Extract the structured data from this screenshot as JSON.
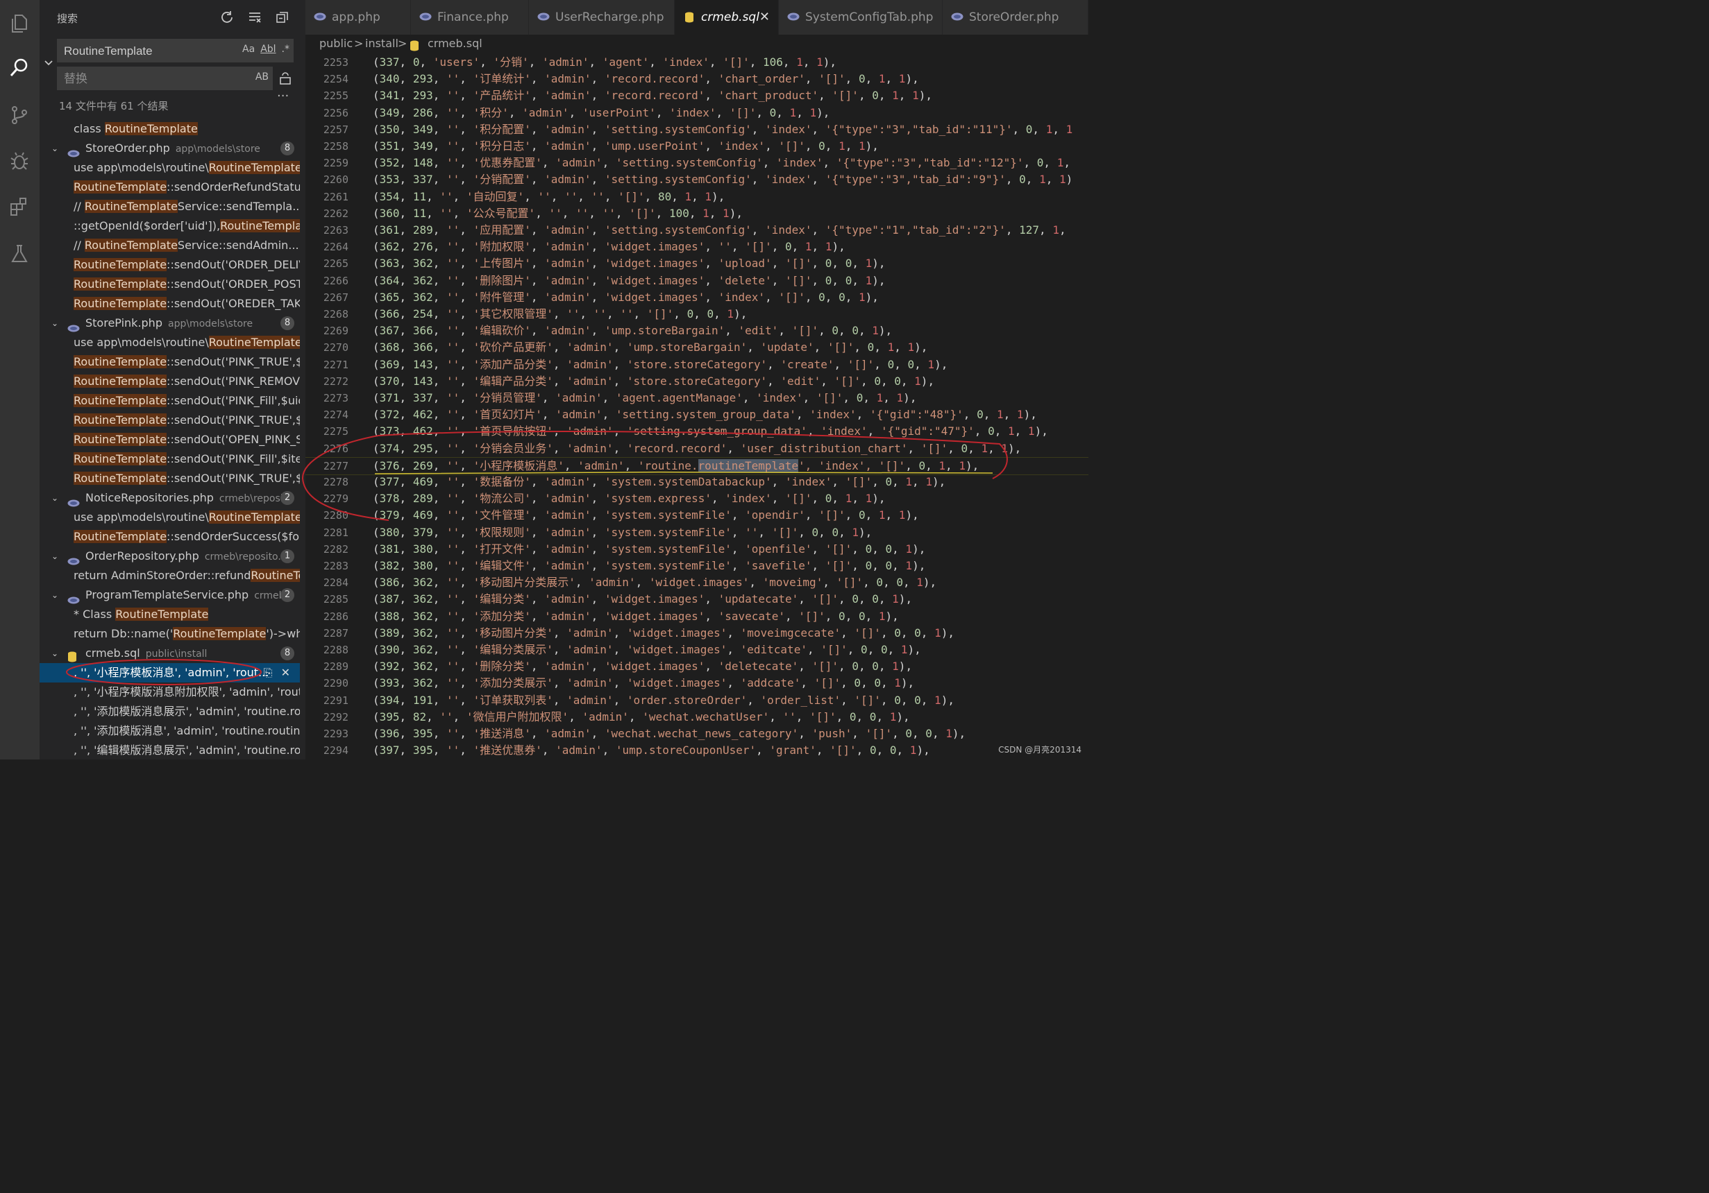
{
  "sidebar": {
    "title": "搜索",
    "search_value": "RoutineTemplate",
    "search_opts": [
      "Aa",
      "Abl",
      ".*"
    ],
    "replace_placeholder": "替换",
    "replace_opt": "AB",
    "results_summary": "14 文件中有 61 个结果",
    "rows": [
      {
        "type": "match",
        "pre": "class ",
        "hl": "RoutineTemplate",
        "post": ""
      },
      {
        "type": "file",
        "name": "StoreOrder.php",
        "path": "app\\models\\store",
        "count": "8"
      },
      {
        "type": "match",
        "pre": "use app\\models\\routine\\",
        "hl": "RoutineTemplate",
        "post": ";"
      },
      {
        "type": "match",
        "pre": "",
        "hl": "RoutineTemplate",
        "post": "::sendOrderRefundStatus($..."
      },
      {
        "type": "match",
        "pre": "//          ",
        "hl": "RoutineTemplate",
        "post": "Service::sendTempla..."
      },
      {
        "type": "match",
        "pre": "::getOpenId($order['uid']),",
        "hl": "RoutineTemplate",
        "post": "S..."
      },
      {
        "type": "match",
        "pre": "//          ",
        "hl": "RoutineTemplate",
        "post": "Service::sendAdmin..."
      },
      {
        "type": "match",
        "pre": "",
        "hl": "RoutineTemplate",
        "post": "::sendOut('ORDER_DELIVER..."
      },
      {
        "type": "match",
        "pre": "",
        "hl": "RoutineTemplate",
        "post": "::sendOut('ORDER_POSTAG..."
      },
      {
        "type": "match",
        "pre": "",
        "hl": "RoutineTemplate",
        "post": "::sendOut('OREDER_TAKEV..."
      },
      {
        "type": "file",
        "name": "StorePink.php",
        "path": "app\\models\\store",
        "count": "8"
      },
      {
        "type": "match",
        "pre": "use app\\models\\routine\\",
        "hl": "RoutineTemplate",
        "post": ";"
      },
      {
        "type": "match",
        "pre": "",
        "hl": "RoutineTemplate",
        "post": "::sendOut('PINK_TRUE',$ite..."
      },
      {
        "type": "match",
        "pre": "",
        "hl": "RoutineTemplate",
        "post": "::sendOut('PINK_REMOVE',..."
      },
      {
        "type": "match",
        "pre": "",
        "hl": "RoutineTemplate",
        "post": "::sendOut('PINK_Fill',$uid,["
      },
      {
        "type": "match",
        "pre": "",
        "hl": "RoutineTemplate",
        "post": "::sendOut('PINK_TRUE',$or..."
      },
      {
        "type": "match",
        "pre": "",
        "hl": "RoutineTemplate",
        "post": "::sendOut('OPEN_PINK_SU..."
      },
      {
        "type": "match",
        "pre": "",
        "hl": "RoutineTemplate",
        "post": "::sendOut('PINK_Fill',$item,["
      },
      {
        "type": "match",
        "pre": "",
        "hl": "RoutineTemplate",
        "post": "::sendOut('PINK_TRUE',$ite..."
      },
      {
        "type": "file",
        "name": "NoticeRepositories.php",
        "path": "crmeb\\reposi...",
        "count": "2"
      },
      {
        "type": "match",
        "pre": "use app\\models\\routine\\",
        "hl": "RoutineTemplate",
        "post": ";"
      },
      {
        "type": "match",
        "pre": "",
        "hl": "RoutineTemplate",
        "post": "::sendOrderSuccess($forml..."
      },
      {
        "type": "file",
        "name": "OrderRepository.php",
        "path": "crmeb\\reposito...",
        "count": "1"
      },
      {
        "type": "match",
        "pre": "return AdminStoreOrder::refund",
        "hl": "RoutineTem...",
        "post": ""
      },
      {
        "type": "file",
        "name": "ProgramTemplateService.php",
        "path": "crmeb...",
        "count": "2"
      },
      {
        "type": "match",
        "pre": "* Class ",
        "hl": "RoutineTemplate",
        "post": ""
      },
      {
        "type": "match",
        "pre": "return Db::name('",
        "hl": "RoutineTemplate",
        "post": "')->where..."
      },
      {
        "type": "file",
        "name": "crmeb.sql",
        "path": "public\\install",
        "count": "8",
        "sql": true
      },
      {
        "type": "match",
        "pre": ", '', '小程序模板消息', 'admin', 'rout...",
        "hl": "",
        "post": "",
        "selected": true
      },
      {
        "type": "match",
        "pre": ", '', '小程序模版消息附加权限', 'admin', 'routi...",
        "hl": "",
        "post": ""
      },
      {
        "type": "match",
        "pre": ", '', '添加模版消息展示', 'admin', 'routine.rou...",
        "hl": "",
        "post": ""
      },
      {
        "type": "match",
        "pre": ", '', '添加模版消息', 'admin', 'routine.routineT...",
        "hl": "",
        "post": ""
      },
      {
        "type": "match",
        "pre": ", '', '编辑模版消息展示', 'admin', 'routine.rou...",
        "hl": "",
        "post": ""
      }
    ]
  },
  "tabs": [
    {
      "label": "app.php",
      "active": false
    },
    {
      "label": "Finance.php",
      "active": false
    },
    {
      "label": "UserRecharge.php",
      "active": false
    },
    {
      "label": "crmeb.sql",
      "active": true
    },
    {
      "label": "SystemConfigTab.php",
      "active": false
    },
    {
      "label": "StoreOrder.php",
      "active": false
    }
  ],
  "breadcrumb": {
    "parts": [
      "public",
      ">",
      "install",
      ">"
    ],
    "file": "crmeb.sql"
  },
  "editor": {
    "lines": [
      {
        "n": "2253",
        "c": "(337, 0, 'users', '分销', 'admin', 'agent', 'index', '[]', 106, 1, 1),"
      },
      {
        "n": "2254",
        "c": "(340, 293, '', '订单统计', 'admin', 'record.record', 'chart_order', '[]', 0, 1, 1),"
      },
      {
        "n": "2255",
        "c": "(341, 293, '', '产品统计', 'admin', 'record.record', 'chart_product', '[]', 0, 1, 1),"
      },
      {
        "n": "2256",
        "c": "(349, 286, '', '积分', 'admin', 'userPoint', 'index', '[]', 0, 1, 1),"
      },
      {
        "n": "2257",
        "c": "(350, 349, '', '积分配置', 'admin', 'setting.systemConfig', 'index', '{\"type\":\"3\",\"tab_id\":\"11\"}', 0, 1, 1"
      },
      {
        "n": "2258",
        "c": "(351, 349, '', '积分日志', 'admin', 'ump.userPoint', 'index', '[]', 0, 1, 1),"
      },
      {
        "n": "2259",
        "c": "(352, 148, '', '优惠券配置', 'admin', 'setting.systemConfig', 'index', '{\"type\":\"3\",\"tab_id\":\"12\"}', 0, 1,"
      },
      {
        "n": "2260",
        "c": "(353, 337, '', '分销配置', 'admin', 'setting.systemConfig', 'index', '{\"type\":\"3\",\"tab_id\":\"9\"}', 0, 1, 1)"
      },
      {
        "n": "2261",
        "c": "(354, 11, '', '自动回复', '', '', '', '[]', 80, 1, 1),"
      },
      {
        "n": "2262",
        "c": "(360, 11, '', '公众号配置', '', '', '', '[]', 100, 1, 1),"
      },
      {
        "n": "2263",
        "c": "(361, 289, '', '应用配置', 'admin', 'setting.systemConfig', 'index', '{\"type\":\"1\",\"tab_id\":\"2\"}', 127, 1,"
      },
      {
        "n": "2264",
        "c": "(362, 276, '', '附加权限', 'admin', 'widget.images', '', '[]', 0, 1, 1),"
      },
      {
        "n": "2265",
        "c": "(363, 362, '', '上传图片', 'admin', 'widget.images', 'upload', '[]', 0, 0, 1),"
      },
      {
        "n": "2266",
        "c": "(364, 362, '', '删除图片', 'admin', 'widget.images', 'delete', '[]', 0, 0, 1),"
      },
      {
        "n": "2267",
        "c": "(365, 362, '', '附件管理', 'admin', 'widget.images', 'index', '[]', 0, 0, 1),"
      },
      {
        "n": "2268",
        "c": "(366, 254, '', '其它权限管理', '', '', '', '[]', 0, 0, 1),"
      },
      {
        "n": "2269",
        "c": "(367, 366, '', '编辑砍价', 'admin', 'ump.storeBargain', 'edit', '[]', 0, 0, 1),"
      },
      {
        "n": "2270",
        "c": "(368, 366, '', '砍价产品更新', 'admin', 'ump.storeBargain', 'update', '[]', 0, 1, 1),"
      },
      {
        "n": "2271",
        "c": "(369, 143, '', '添加产品分类', 'admin', 'store.storeCategory', 'create', '[]', 0, 0, 1),"
      },
      {
        "n": "2272",
        "c": "(370, 143, '', '编辑产品分类', 'admin', 'store.storeCategory', 'edit', '[]', 0, 0, 1),"
      },
      {
        "n": "2273",
        "c": "(371, 337, '', '分销员管理', 'admin', 'agent.agentManage', 'index', '[]', 0, 1, 1),"
      },
      {
        "n": "2274",
        "c": "(372, 462, '', '首页幻灯片', 'admin', 'setting.system_group_data', 'index', '{\"gid\":\"48\"}', 0, 1, 1),"
      },
      {
        "n": "2275",
        "c": "(373, 462, '', '首页导航按钮', 'admin', 'setting.system_group_data', 'index', '{\"gid\":\"47\"}', 0, 1, 1),"
      },
      {
        "n": "2276",
        "c": "(374, 295, '', '分销会员业务', 'admin', 'record.record', 'user_distribution_chart', '[]', 0, 1, 1),"
      },
      {
        "n": "2277",
        "pre": "(376, 269, '', '小程序模板消息', 'admin', 'routine.",
        "hl": "routineTemplate",
        "post": "', 'index', '[]', 0, 1, 1),",
        "current": true
      },
      {
        "n": "2278",
        "c": "(377, 469, '', '数据备份', 'admin', 'system.systemDatabackup', 'index', '[]', 0, 1, 1),"
      },
      {
        "n": "2279",
        "c": "(378, 289, '', '物流公司', 'admin', 'system.express', 'index', '[]', 0, 1, 1),"
      },
      {
        "n": "2280",
        "c": "(379, 469, '', '文件管理', 'admin', 'system.systemFile', 'opendir', '[]', 0, 1, 1),"
      },
      {
        "n": "2281",
        "c": "(380, 379, '', '权限规则', 'admin', 'system.systemFile', '', '[]', 0, 0, 1),"
      },
      {
        "n": "2282",
        "c": "(381, 380, '', '打开文件', 'admin', 'system.systemFile', 'openfile', '[]', 0, 0, 1),"
      },
      {
        "n": "2283",
        "c": "(382, 380, '', '编辑文件', 'admin', 'system.systemFile', 'savefile', '[]', 0, 0, 1),"
      },
      {
        "n": "2284",
        "c": "(386, 362, '', '移动图片分类展示', 'admin', 'widget.images', 'moveimg', '[]', 0, 0, 1),"
      },
      {
        "n": "2285",
        "c": "(387, 362, '', '编辑分类', 'admin', 'widget.images', 'updatecate', '[]', 0, 0, 1),"
      },
      {
        "n": "2286",
        "c": "(388, 362, '', '添加分类', 'admin', 'widget.images', 'savecate', '[]', 0, 0, 1),"
      },
      {
        "n": "2287",
        "c": "(389, 362, '', '移动图片分类', 'admin', 'widget.images', 'moveimgcecate', '[]', 0, 0, 1),"
      },
      {
        "n": "2288",
        "c": "(390, 362, '', '编辑分类展示', 'admin', 'widget.images', 'editcate', '[]', 0, 0, 1),"
      },
      {
        "n": "2289",
        "c": "(392, 362, '', '删除分类', 'admin', 'widget.images', 'deletecate', '[]', 0, 0, 1),"
      },
      {
        "n": "2290",
        "c": "(393, 362, '', '添加分类展示', 'admin', 'widget.images', 'addcate', '[]', 0, 0, 1),"
      },
      {
        "n": "2291",
        "c": "(394, 191, '', '订单获取列表', 'admin', 'order.storeOrder', 'order_list', '[]', 0, 0, 1),"
      },
      {
        "n": "2292",
        "c": "(395, 82, '', '微信用户附加权限', 'admin', 'wechat.wechatUser', '', '[]', 0, 0, 1),"
      },
      {
        "n": "2293",
        "c": "(396, 395, '', '推送消息', 'admin', 'wechat.wechat_news_category', 'push', '[]', 0, 0, 1),"
      },
      {
        "n": "2294",
        "c": "(397, 395, '', '推送优惠券', 'admin', 'ump.storeCouponUser', 'grant', '[]', 0, 0, 1),"
      }
    ]
  },
  "watermark": "CSDN @月亮201314",
  "colors": {
    "highlight": "#613214",
    "selected": "#094771",
    "annotation": "#c0262d"
  }
}
